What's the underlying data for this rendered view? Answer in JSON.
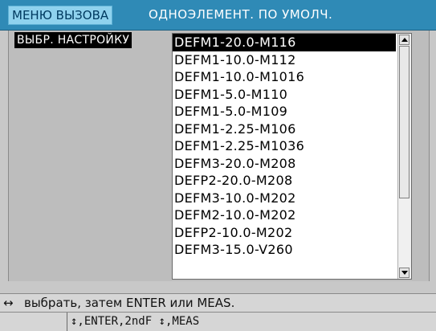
{
  "titlebar": {
    "menu_tab": "МЕНЮ ВЫЗОВА",
    "title": "ОДНОЭЛЕМЕНТ. ПО УМОЛЧ."
  },
  "main": {
    "setting_label": "ВЫБР. НАСТРОЙКУ",
    "list": {
      "selected_index": 0,
      "items": [
        "DEFM1-20.0-M116",
        "DEFM1-10.0-M112",
        "DEFM1-10.0-M1016",
        "DEFM1-5.0-M110",
        "DEFM1-5.0-M109",
        "DEFM1-2.25-M106",
        "DEFM1-2.25-M1036",
        "DEFM3-20.0-M208",
        "DEFP2-20.0-M208",
        "DEFM3-10.0-M202",
        "DEFM2-10.0-M202",
        "DEFP2-10.0-M202",
        "DEFM3-15.0-V260"
      ]
    }
  },
  "status": {
    "hint_arrow": "↔",
    "hint_text": "выбрать, затем ENTER или MEAS.",
    "keys": "↕,ENTER,2ndF ↕,MEAS"
  },
  "colors": {
    "titlebar": "#2f8ab6",
    "menu_tab": "#8fd2ee",
    "background": "#bdbdbd"
  }
}
